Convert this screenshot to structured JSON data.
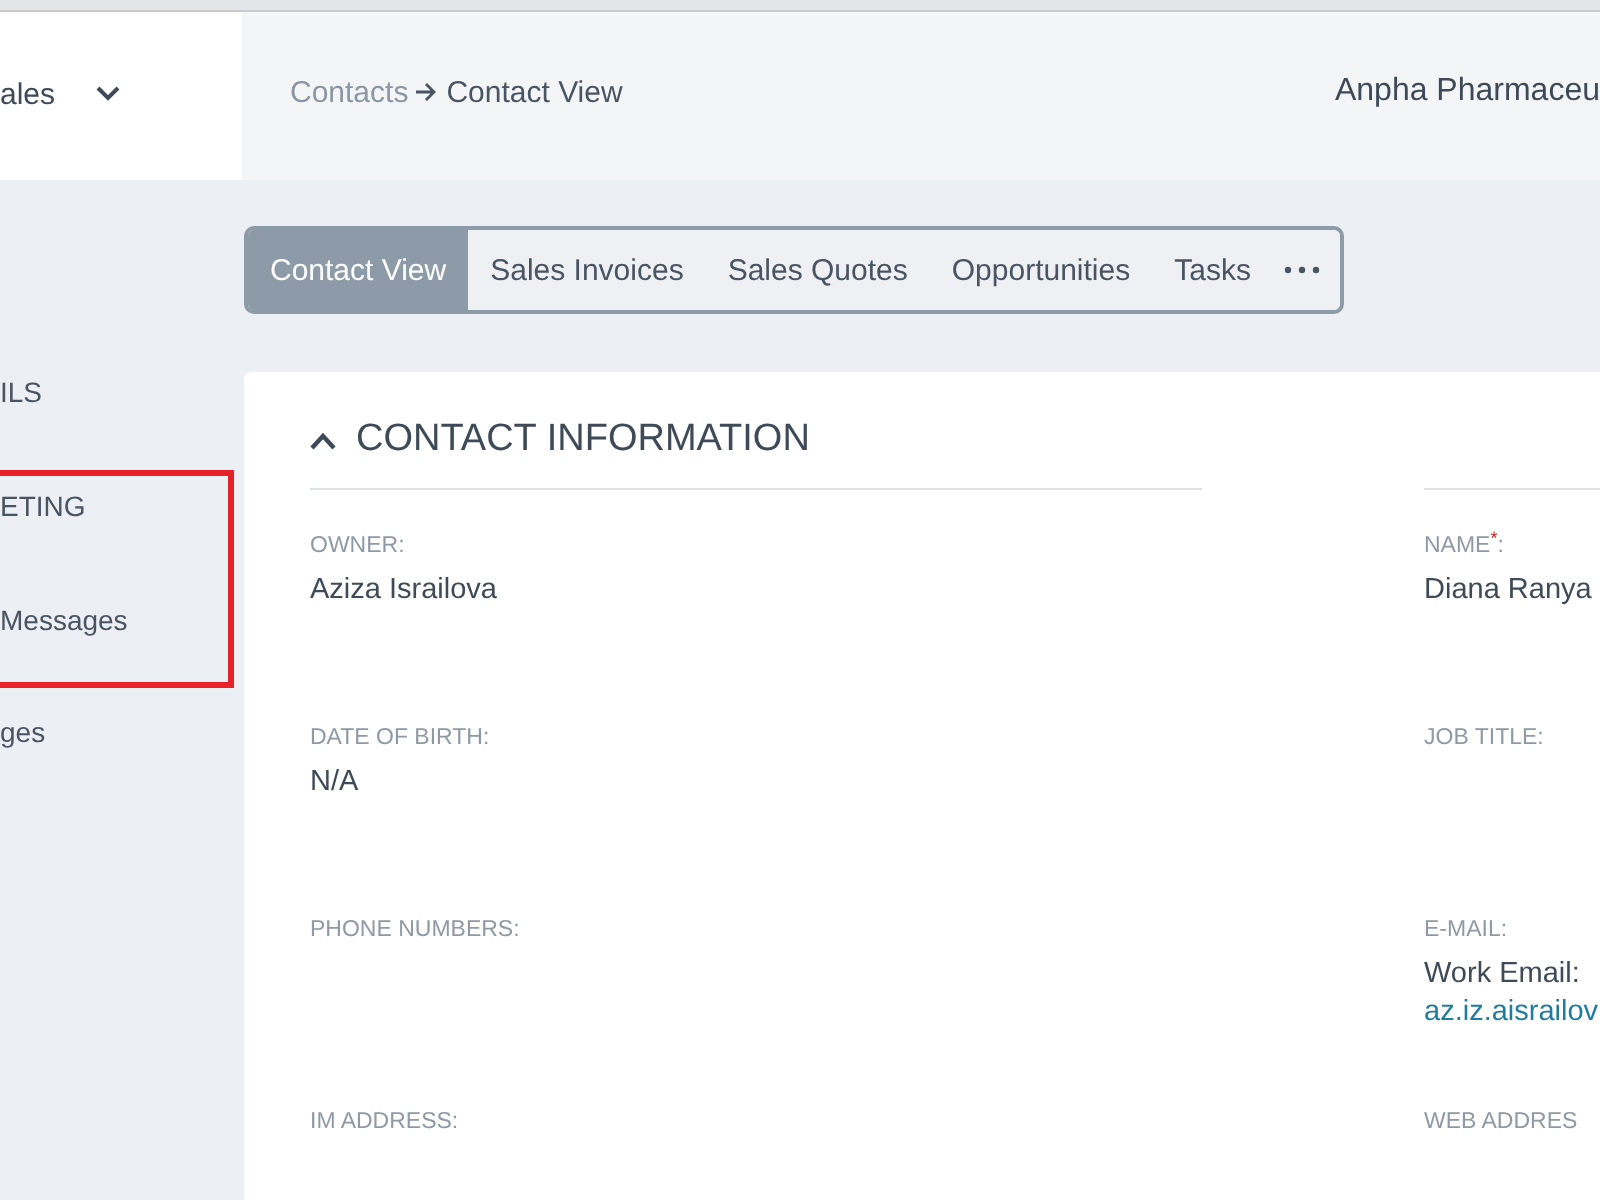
{
  "sidebar": {
    "app_switcher": {
      "label": "ales"
    },
    "items": [
      {
        "label": "ILS",
        "kind": "section"
      },
      {
        "label": "ETING",
        "kind": "section"
      },
      {
        "label": "Messages",
        "kind": "link"
      },
      {
        "label": "ges",
        "kind": "link"
      }
    ]
  },
  "breadcrumb": {
    "parent": "Contacts",
    "current": "Contact View"
  },
  "company": "Anpha Pharmaceu",
  "tabs": [
    {
      "label": "Contact View",
      "selected": true
    },
    {
      "label": "Sales Invoices",
      "selected": false
    },
    {
      "label": "Sales Quotes",
      "selected": false
    },
    {
      "label": "Opportunities",
      "selected": false
    },
    {
      "label": "Tasks",
      "selected": false
    }
  ],
  "section": {
    "title": "CONTACT INFORMATION",
    "expanded": true,
    "rows": [
      {
        "left": {
          "label": "OWNER:",
          "values": [
            "Aziza Israilova"
          ]
        },
        "right": {
          "label": "NAME$^{*}$:",
          "values": [
            "Diana Ranya"
          ]
        }
      },
      {
        "left": {
          "label": "DATE OF BIRTH:",
          "values": [
            "N/A"
          ]
        },
        "right": {
          "label": "JOB TITLE:"
        }
      },
      {
        "left": {
          "label": "PHONE NUMBERS:"
        },
        "right": {
          "label": "E-MAIL:",
          "values": [
            "Work Email:"
          ],
          "link": "az.iz.aisrailov"
        }
      },
      {
        "left": {
          "label": "IM ADDRESS:"
        },
        "right": {
          "label": "WEB ADDRES"
        }
      }
    ]
  }
}
